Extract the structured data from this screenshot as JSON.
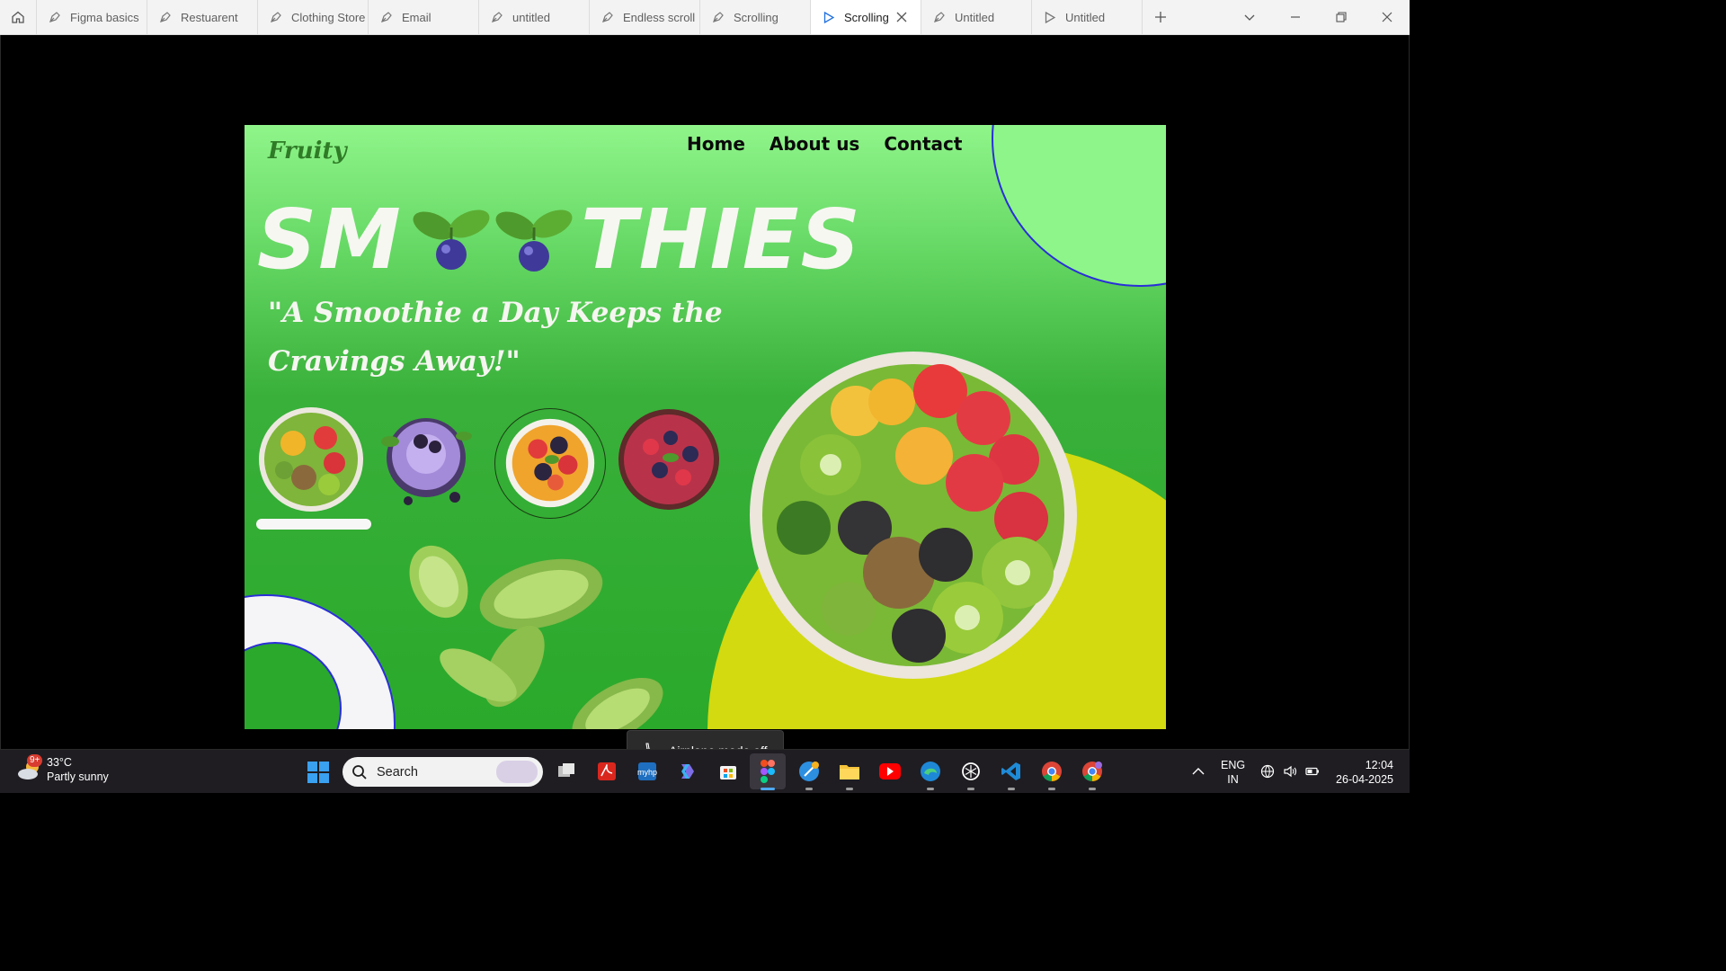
{
  "tabs": [
    {
      "label": "Figma basics",
      "icon": "figma-file-icon",
      "active": false
    },
    {
      "label": "Restuarent",
      "icon": "figma-file-icon",
      "active": false
    },
    {
      "label": "Clothing Store",
      "icon": "figma-file-icon",
      "active": false
    },
    {
      "label": "Email",
      "icon": "figma-file-icon",
      "active": false
    },
    {
      "label": "untitled",
      "icon": "figma-file-icon",
      "active": false
    },
    {
      "label": "Endless scroll",
      "icon": "figma-file-icon",
      "active": false
    },
    {
      "label": "Scrolling",
      "icon": "figma-file-icon",
      "active": false
    },
    {
      "label": "Scrolling",
      "icon": "prototype-play-icon",
      "active": true
    },
    {
      "label": "Untitled",
      "icon": "figma-file-icon",
      "active": false
    },
    {
      "label": "Untitled",
      "icon": "prototype-play-icon",
      "active": false
    }
  ],
  "design": {
    "brand": "Fruity",
    "nav": [
      "Home",
      "About us",
      "Contact"
    ],
    "hero_left": "SM",
    "hero_right": "THIES",
    "quote": "\"A Smoothie a Day Keeps the Cravings Away!\"",
    "selected_thumb": 3,
    "colors": {
      "bg_top": "#8ff58a",
      "bg_bottom": "#2aa92b",
      "accent_yellow": "#d3da10",
      "ring_stroke": "#2a2fd8",
      "brand_text": "#2f7b26"
    }
  },
  "toast": {
    "text": "Airplane mode off",
    "icon": "airplane-icon"
  },
  "taskbar": {
    "weather_temp": "33°C",
    "weather_desc": "Partly sunny",
    "weather_badge": "9+",
    "search_placeholder": "Search",
    "apps": [
      "task-view-icon",
      "acrobat-icon",
      "myhp-icon",
      "copilot-icon",
      "ms-store-icon",
      "figma-icon",
      "qa-icon",
      "file-explorer-icon",
      "youtube-icon",
      "edge-icon",
      "chatgpt-icon",
      "vscode-icon",
      "chrome-icon",
      "chrome-profile-icon"
    ],
    "lang_top": "ENG",
    "lang_bottom": "IN",
    "time": "12:04",
    "date": "26-04-2025"
  }
}
